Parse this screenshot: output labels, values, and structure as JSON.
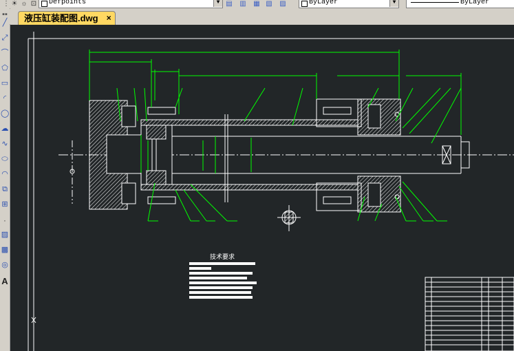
{
  "toolbar": {
    "point_style_value": "Defpoints",
    "layer_value": "ByLayer",
    "linetype_value": "ByLayer"
  },
  "document_tab": {
    "title": "液压缸装配图.dwg",
    "close_glyph": "×"
  },
  "drawing": {
    "tech_requirements_title": "技术要求"
  },
  "colors": {
    "canvas_bg": "#222628",
    "outline": "#ffffff",
    "dimension": "#00ff00",
    "hatch": "#ffffff"
  },
  "left_tools": [
    "line-icon",
    "construction-line-icon",
    "polyline-icon",
    "polygon-icon",
    "rectangle-icon",
    "arc-icon",
    "circle-icon",
    "revision-cloud-icon",
    "spline-icon",
    "ellipse-icon",
    "ellipse-arc-icon",
    "insert-block-icon",
    "make-block-icon",
    "point-icon",
    "hatch-icon",
    "gradient-icon",
    "region-icon",
    "multiline-text-icon"
  ]
}
